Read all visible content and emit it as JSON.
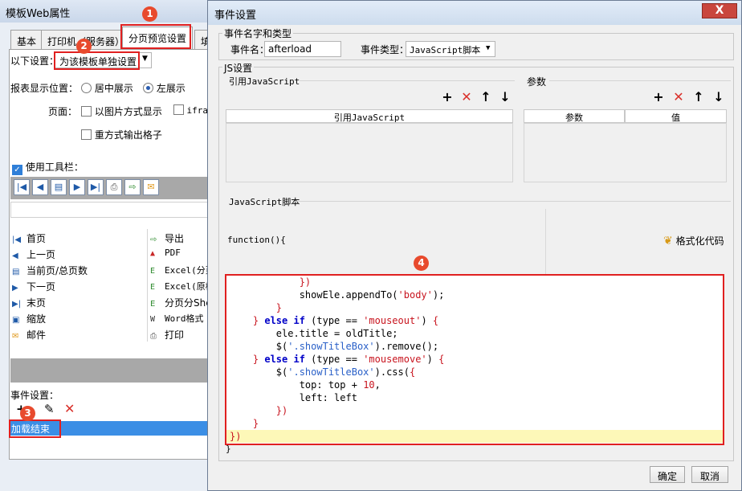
{
  "left_window": {
    "title": "模板Web属性",
    "tabs": [
      "基本",
      "打印机（服务器）",
      "分页预览设置",
      "填"
    ],
    "setting_label": "以下设置：",
    "setting_value": "为该模板单独设置",
    "report_position_label": "报表显示位置：",
    "position_options": [
      "居中展示",
      "左展示"
    ],
    "page_label": "页面：",
    "page_options": [
      "以图片方式显示",
      "ifra",
      "重方式输出格子"
    ],
    "toolbar_label": "使用工具栏：",
    "list_left": [
      "首页",
      "上一页",
      "当前页/总页数",
      "下一页",
      "末页",
      "缩放",
      "邮件"
    ],
    "list_right": [
      "导出",
      "PDF",
      "Excel(分页",
      "Excel(原样",
      "分页分She",
      "Word格式",
      "打印"
    ],
    "event_label": "事件设置：",
    "event_item": "加载结束"
  },
  "badges": [
    "1",
    "2",
    "3",
    "4"
  ],
  "dialog": {
    "title": "事件设置",
    "close_glyph": "X",
    "name_group_label": "事件名字和类型",
    "event_name_label": "事件名：",
    "event_name_value": "afterload",
    "event_type_label": "事件类型：",
    "event_type_value": "JavaScript脚本",
    "js_group_label": "JS设置",
    "ref_js_label": "引用JavaScript",
    "params_label": "参数",
    "ref_js_column": "引用JavaScript",
    "param_columns": [
      "参数",
      "值"
    ],
    "script_label": "JavaScript脚本",
    "function_header": "function(){",
    "format_code_label": "格式化代码",
    "closing_brace": "}",
    "ok_label": "确定",
    "cancel_label": "取消"
  },
  "code_lines": [
    {
      "indent": "            ",
      "parts": [
        {
          "t": "})",
          "c": "br"
        }
      ]
    },
    {
      "indent": "            ",
      "parts": [
        {
          "t": "showEle.appendTo(",
          "c": ""
        },
        {
          "t": "'body'",
          "c": "str"
        },
        {
          "t": ");",
          "c": ""
        }
      ]
    },
    {
      "indent": "        ",
      "parts": [
        {
          "t": "}",
          "c": "br"
        }
      ]
    },
    {
      "indent": "    ",
      "parts": [
        {
          "t": "} ",
          "c": "br"
        },
        {
          "t": "else if",
          "c": "kw"
        },
        {
          "t": " (type == ",
          "c": ""
        },
        {
          "t": "'mouseout'",
          "c": "str"
        },
        {
          "t": ") ",
          "c": ""
        },
        {
          "t": "{",
          "c": "br"
        }
      ]
    },
    {
      "indent": "        ",
      "parts": [
        {
          "t": "ele.title = oldTitle;",
          "c": ""
        }
      ]
    },
    {
      "indent": "        ",
      "parts": [
        {
          "t": "$(",
          "c": ""
        },
        {
          "t": "'.showTitleBox'",
          "c": "fn"
        },
        {
          "t": ").remove();",
          "c": ""
        }
      ]
    },
    {
      "indent": "    ",
      "parts": [
        {
          "t": "} ",
          "c": "br"
        },
        {
          "t": "else if",
          "c": "kw"
        },
        {
          "t": " (type == ",
          "c": ""
        },
        {
          "t": "'mousemove'",
          "c": "str"
        },
        {
          "t": ") ",
          "c": ""
        },
        {
          "t": "{",
          "c": "br"
        }
      ]
    },
    {
      "indent": "        ",
      "parts": [
        {
          "t": "$(",
          "c": ""
        },
        {
          "t": "'.showTitleBox'",
          "c": "fn"
        },
        {
          "t": ").css(",
          "c": ""
        },
        {
          "t": "{",
          "c": "br"
        }
      ]
    },
    {
      "indent": "            ",
      "parts": [
        {
          "t": "top: top + ",
          "c": ""
        },
        {
          "t": "10",
          "c": "str"
        },
        {
          "t": ",",
          "c": ""
        }
      ]
    },
    {
      "indent": "            ",
      "parts": [
        {
          "t": "left: left",
          "c": ""
        }
      ]
    },
    {
      "indent": "        ",
      "parts": [
        {
          "t": "})",
          "c": "br"
        }
      ]
    },
    {
      "indent": "    ",
      "parts": [
        {
          "t": "}",
          "c": "br"
        }
      ]
    },
    {
      "indent": "",
      "parts": [
        {
          "t": "})",
          "c": "br"
        }
      ]
    }
  ]
}
